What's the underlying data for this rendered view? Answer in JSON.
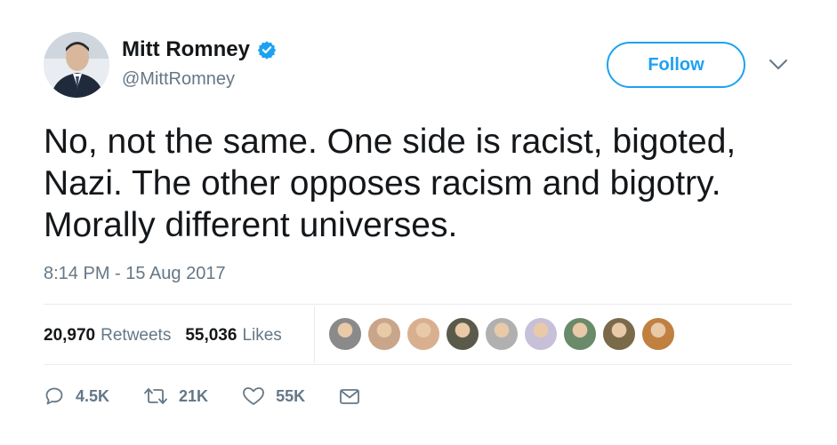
{
  "user": {
    "display_name": "Mitt Romney",
    "handle": "@MittRomney",
    "verified": true
  },
  "follow_label": "Follow",
  "tweet": {
    "text": "No, not the same. One side is racist, bigoted, Nazi. The other opposes racism and bigotry. Morally different universes.",
    "timestamp": "8:14 PM - 15 Aug 2017"
  },
  "stats": {
    "retweets_count": "20,970",
    "retweets_label": "Retweets",
    "likes_count": "55,036",
    "likes_label": "Likes"
  },
  "actions": {
    "reply_count": "4.5K",
    "retweet_count": "21K",
    "like_count": "55K"
  },
  "liker_avatar_colors": [
    "#8a8a8a",
    "#c9a58a",
    "#d8b090",
    "#5a5a4a",
    "#b0b0b0",
    "#c8c0d8",
    "#6a8a6a",
    "#7a6a4a",
    "#c08040"
  ],
  "colors": {
    "accent": "#1da1f2",
    "text": "#14171a",
    "muted": "#657786",
    "divider": "#e6ecf0"
  }
}
